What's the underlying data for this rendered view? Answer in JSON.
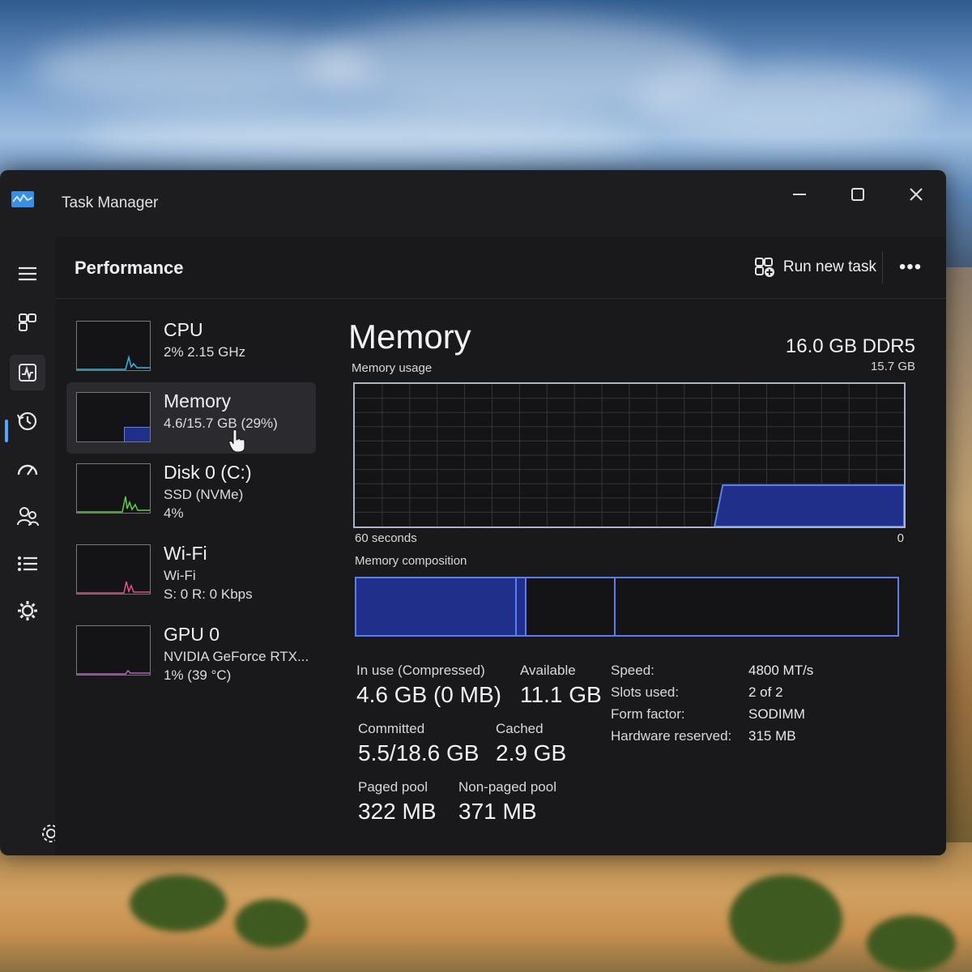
{
  "window": {
    "title": "Task Manager",
    "buttons": {
      "minimize": "minimize",
      "maximize": "maximize",
      "close": "close"
    }
  },
  "header": {
    "title": "Performance",
    "run_new_task": "Run new task",
    "more": "•••"
  },
  "nav": {
    "items": [
      "hamburger-icon",
      "processes-icon",
      "performance-icon",
      "history-icon",
      "startup-icon",
      "users-icon",
      "details-icon",
      "services-icon"
    ],
    "active_index": 2,
    "settings": "gear-icon"
  },
  "devices": [
    {
      "name": "CPU",
      "sub1": "2% 2.15 GHz",
      "sub2": ""
    },
    {
      "name": "Memory",
      "sub1": "4.6/15.7 GB (29%)",
      "sub2": ""
    },
    {
      "name": "Disk 0 (C:)",
      "sub1": "SSD (NVMe)",
      "sub2": "4%"
    },
    {
      "name": "Wi-Fi",
      "sub1": "Wi-Fi",
      "sub2": "S: 0 R: 0 Kbps"
    },
    {
      "name": "GPU 0",
      "sub1": "NVIDIA GeForce RTX...",
      "sub2": "1% (39 °C)"
    }
  ],
  "memory": {
    "title": "Memory",
    "spec": "16.0 GB DDR5",
    "usage_label": "Memory usage",
    "max_label": "15.7 GB",
    "time_label": "60 seconds",
    "zero_label": "0",
    "composition_label": "Memory composition",
    "usage_fraction": 0.29,
    "stats": {
      "in_use_label": "In use (Compressed)",
      "in_use_value": "4.6 GB (0 MB)",
      "available_label": "Available",
      "available_value": "11.1 GB",
      "committed_label": "Committed",
      "committed_value": "5.5/18.6 GB",
      "cached_label": "Cached",
      "cached_value": "2.9 GB",
      "paged_label": "Paged pool",
      "paged_value": "322 MB",
      "nonpaged_label": "Non-paged pool",
      "nonpaged_value": "371 MB"
    },
    "specs": {
      "speed_label": "Speed:",
      "speed_value": "4800 MT/s",
      "slots_label": "Slots used:",
      "slots_value": "2 of 2",
      "form_label": "Form factor:",
      "form_value": "SODIMM",
      "hw_label": "Hardware reserved:",
      "hw_value": "315 MB"
    }
  },
  "colors": {
    "accent": "#4ea8ff",
    "memory_fill": "#1f2f8a",
    "memory_line": "#5a7ef0",
    "cpu_line": "#2fb8e0",
    "disk_line": "#5fd040",
    "wifi_line": "#e0508a",
    "gpu_line": "#c060c0"
  }
}
